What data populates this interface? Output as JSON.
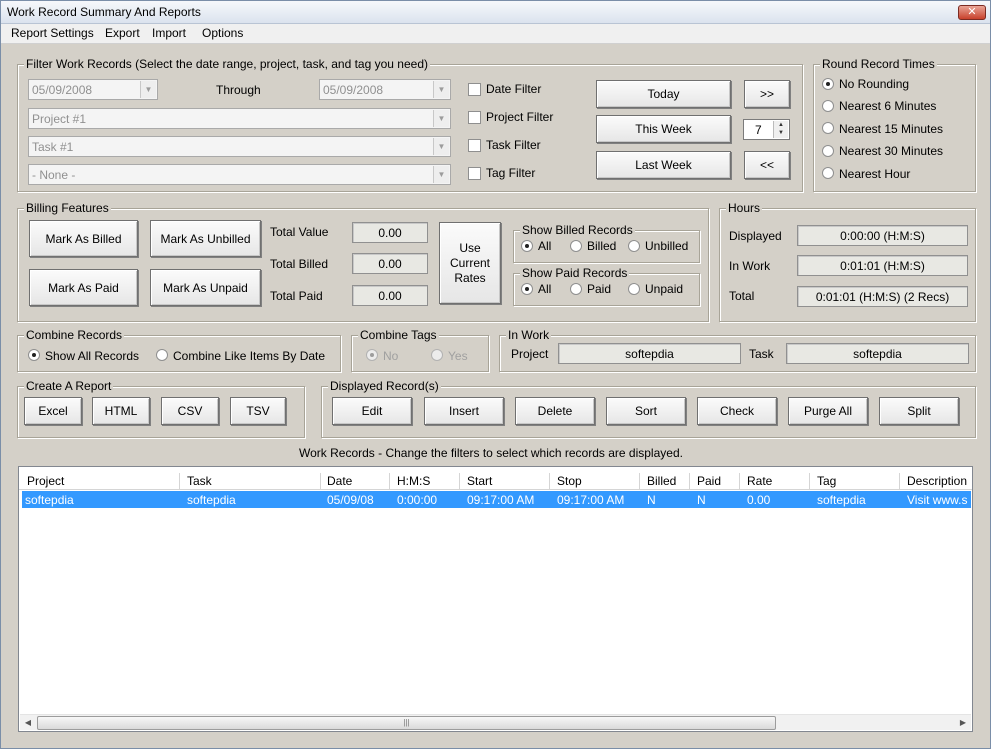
{
  "window": {
    "title": "Work Record Summary And Reports",
    "close_label": "✕"
  },
  "menu": [
    "Report Settings",
    "Export",
    "Import",
    "Options"
  ],
  "filter": {
    "legend": "Filter Work Records (Select the date range, project, task, and tag  you need)",
    "from_date": "05/09/2008",
    "through_label": "Through",
    "to_date": "05/09/2008",
    "project": "Project #1",
    "task": "Task #1",
    "tag": "- None -",
    "checkboxes": [
      "Date Filter",
      "Project Filter",
      "Task Filter",
      "Tag Filter"
    ],
    "buttons": {
      "today": "Today",
      "this_week": "This Week",
      "last_week": "Last Week",
      "next": ">>",
      "prev": "<<"
    },
    "week_count": "7"
  },
  "round": {
    "legend": "Round Record Times",
    "options": [
      "No Rounding",
      "Nearest 6 Minutes",
      "Nearest 15 Minutes",
      "Nearest 30 Minutes",
      "Nearest Hour"
    ],
    "selected": "No Rounding"
  },
  "billing": {
    "legend": "Billing Features",
    "buttons": {
      "mark_billed": "Mark As Billed",
      "mark_unbilled": "Mark As Unbilled",
      "mark_paid": "Mark As Paid",
      "mark_unpaid": "Mark As Unpaid"
    },
    "total_value_label": "Total Value",
    "total_value": "0.00",
    "total_billed_label": "Total Billed",
    "total_billed": "0.00",
    "total_paid_label": "Total Paid",
    "total_paid": "0.00",
    "use_rates": [
      "Use",
      "Current",
      "Rates"
    ],
    "show_billed": {
      "legend": "Show Billed Records",
      "options": [
        "All",
        "Billed",
        "Unbilled"
      ],
      "selected": "All"
    },
    "show_paid": {
      "legend": "Show Paid Records",
      "options": [
        "All",
        "Paid",
        "Unpaid"
      ],
      "selected": "All"
    }
  },
  "hours": {
    "legend": "Hours",
    "displayed_label": "Displayed",
    "displayed": "0:00:00 (H:M:S)",
    "inwork_label": "In Work",
    "inwork": "0:01:01 (H:M:S)",
    "total_label": "Total",
    "total": "0:01:01 (H:M:S) (2 Recs)"
  },
  "combine_records": {
    "legend": "Combine Records",
    "options": [
      "Show All Records",
      "Combine Like Items By Date"
    ],
    "selected": "Show All Records"
  },
  "combine_tags": {
    "legend": "Combine Tags",
    "options": [
      "No",
      "Yes"
    ],
    "selected": "No"
  },
  "in_work": {
    "legend": "In Work",
    "project_label": "Project",
    "project": "softepdia",
    "task_label": "Task",
    "task": "softepdia"
  },
  "create_report": {
    "legend": "Create A Report",
    "buttons": [
      "Excel",
      "HTML",
      "CSV",
      "TSV"
    ]
  },
  "displayed_records": {
    "legend": "Displayed Record(s)",
    "buttons": [
      "Edit",
      "Insert",
      "Delete",
      "Sort",
      "Check",
      "Purge All",
      "Split"
    ]
  },
  "records_caption": "Work Records - Change the filters to select which records are displayed.",
  "table": {
    "columns": [
      "Project",
      "Task",
      "Date",
      "H:M:S",
      "Start",
      "Stop",
      "Billed",
      "Paid",
      "Rate",
      "Tag",
      "Description"
    ],
    "rows": [
      [
        "softepdia",
        "softepdia",
        "05/09/08",
        "0:00:00",
        "09:17:00 AM",
        "09:17:00 AM",
        "N",
        "N",
        "0.00",
        "softepdia",
        "Visit www.s"
      ]
    ]
  },
  "colors": {
    "face": "#d4d0c8",
    "selection": "#3399ff"
  }
}
